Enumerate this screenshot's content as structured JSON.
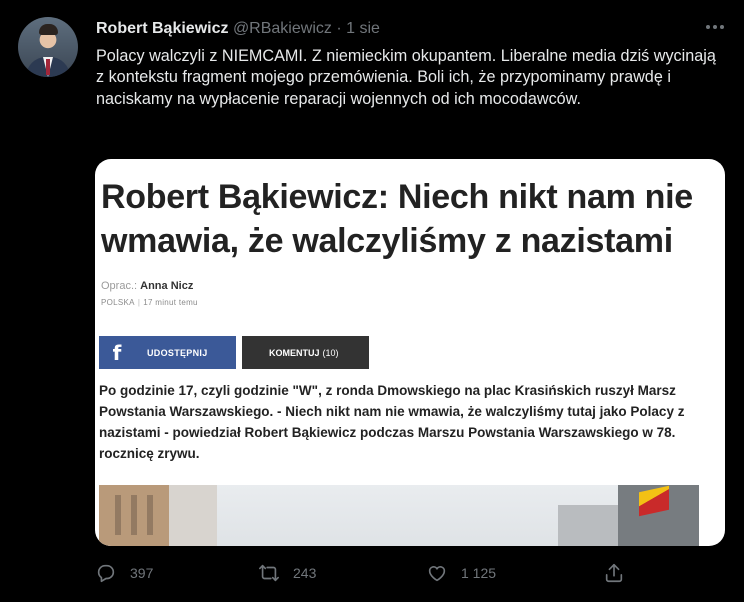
{
  "tweet": {
    "author_name": "Robert Bąkiewicz",
    "handle": "@RBakiewicz",
    "separator": "·",
    "time": "1 sie",
    "text": "Polacy walczyli z NIEMCAMI. Z niemieckim okupantem. Liberalne media dziś wycinają z kontekstu fragment mojego przemówienia. Boli ich, że przypominamy prawdę i naciskamy na wypłacenie reparacji wojennych od ich mocodawców."
  },
  "article": {
    "title": "Robert Bąkiewicz: Niech nikt nam nie wmawia, że walczyliśmy z nazistami",
    "author_label": "Oprac.:",
    "author_name": "Anna Nicz",
    "section": "POLSKA",
    "meta_separator": "|",
    "published": "17 minut temu",
    "share_icon": "f",
    "share_label": "UDOSTĘPNIJ",
    "comment_label": "KOMENTUJ",
    "comment_count": "(10)",
    "lead": "Po godzinie 17, czyli godzinie \"W\", z ronda Dmowskiego na plac Krasińskich ruszył Marsz Powstania Warszawskiego. - Niech nikt nam nie wmawia, że walczyliśmy tutaj jako Polacy z nazistami - powiedział Robert Bąkiewicz podczas Marszu Powstania Warszawskiego w 78. rocznicę zrywu."
  },
  "actions": {
    "reply_count": "397",
    "retweet_count": "243",
    "like_count": "1 125",
    "icons": [
      "reply-icon",
      "retweet-icon",
      "like-icon",
      "share-icon"
    ]
  },
  "colors": {
    "background": "#000000",
    "muted": "#71767b",
    "facebook": "#3b5998"
  }
}
